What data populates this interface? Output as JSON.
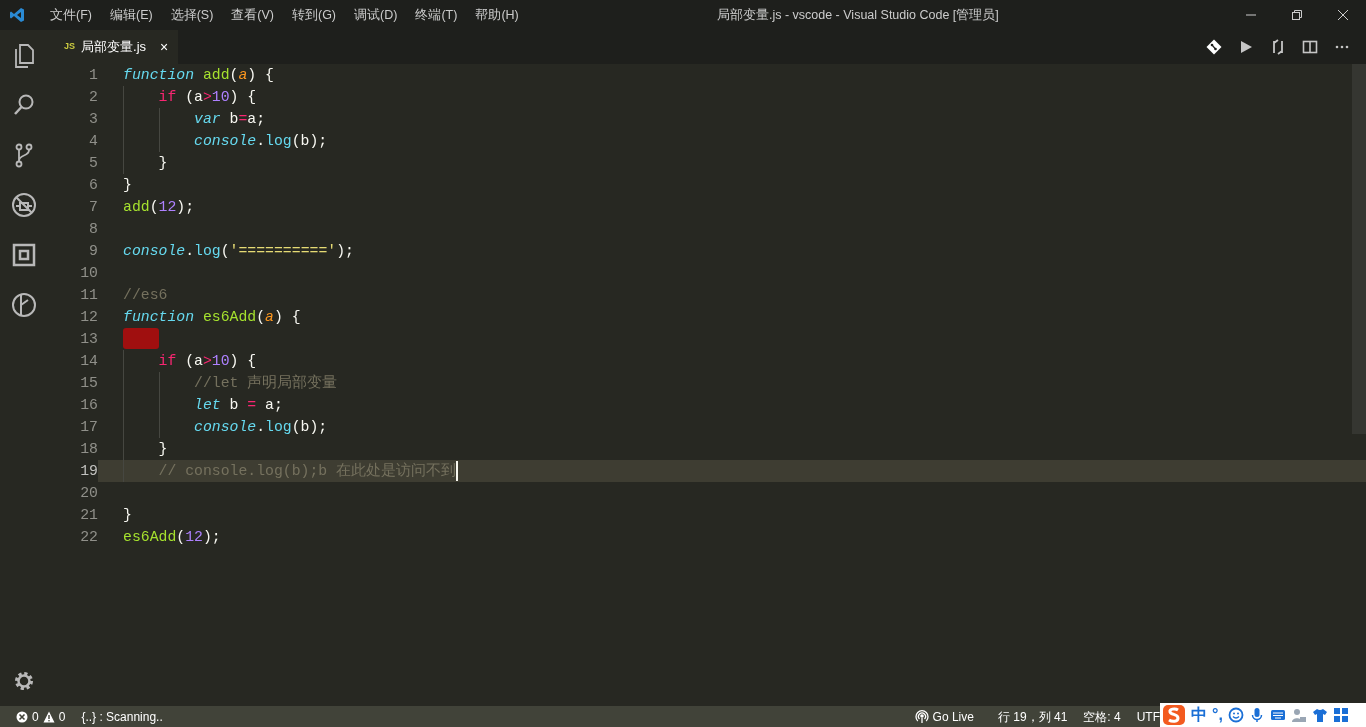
{
  "window": {
    "title": "局部变量.js - vscode - Visual Studio Code [管理员]"
  },
  "menu": [
    "文件(F)",
    "编辑(E)",
    "选择(S)",
    "查看(V)",
    "转到(G)",
    "调试(D)",
    "终端(T)",
    "帮助(H)"
  ],
  "tabs": [
    {
      "badge": "JS",
      "label": "局部变量.js",
      "close": "×",
      "selected": true
    }
  ],
  "editor": {
    "lines": [
      {
        "number": "1",
        "current": false,
        "error": false,
        "tokens": [
          {
            "kind": "keyword",
            "text": "function"
          },
          {
            "kind": "function",
            "text": " add"
          },
          {
            "kind": "plain",
            "text": "("
          },
          {
            "kind": "param",
            "text": "a"
          },
          {
            "kind": "plain",
            "text": ") {"
          }
        ]
      },
      {
        "number": "2",
        "current": false,
        "error": false,
        "tokens": [
          {
            "kind": "control",
            "text": "    if"
          },
          {
            "kind": "plain",
            "text": " (a"
          },
          {
            "kind": "operator",
            "text": ">"
          },
          {
            "kind": "number",
            "text": "10"
          },
          {
            "kind": "plain",
            "text": ") {"
          }
        ]
      },
      {
        "number": "3",
        "current": false,
        "error": false,
        "tokens": [
          {
            "kind": "keyword",
            "text": "        var"
          },
          {
            "kind": "plain",
            "text": " b"
          },
          {
            "kind": "operator",
            "text": "="
          },
          {
            "kind": "plain",
            "text": "a;"
          }
        ]
      },
      {
        "number": "4",
        "current": false,
        "error": false,
        "tokens": [
          {
            "kind": "keyword",
            "text": "        console"
          },
          {
            "kind": "plain",
            "text": "."
          },
          {
            "kind": "method",
            "text": "log"
          },
          {
            "kind": "plain",
            "text": "(b);"
          }
        ]
      },
      {
        "number": "5",
        "current": false,
        "error": false,
        "tokens": [
          {
            "kind": "plain",
            "text": "    }"
          }
        ]
      },
      {
        "number": "6",
        "current": false,
        "error": false,
        "tokens": [
          {
            "kind": "plain",
            "text": "}"
          }
        ]
      },
      {
        "number": "7",
        "current": false,
        "error": false,
        "tokens": [
          {
            "kind": "function",
            "text": "add"
          },
          {
            "kind": "plain",
            "text": "("
          },
          {
            "kind": "number",
            "text": "12"
          },
          {
            "kind": "plain",
            "text": ");"
          }
        ]
      },
      {
        "number": "8",
        "current": false,
        "error": false
      },
      {
        "number": "9",
        "current": false,
        "error": false,
        "tokens": [
          {
            "kind": "keyword",
            "text": "console"
          },
          {
            "kind": "plain",
            "text": "."
          },
          {
            "kind": "method",
            "text": "log"
          },
          {
            "kind": "plain",
            "text": "("
          },
          {
            "kind": "string",
            "text": "'=========='"
          },
          {
            "kind": "plain",
            "text": ");"
          }
        ]
      },
      {
        "number": "10",
        "current": false,
        "error": false
      },
      {
        "number": "11",
        "current": false,
        "error": false,
        "tokens": [
          {
            "kind": "comment",
            "text": "//es6"
          }
        ]
      },
      {
        "number": "12",
        "current": false,
        "error": false,
        "tokens": [
          {
            "kind": "keyword",
            "text": "function"
          },
          {
            "kind": "function",
            "text": " es6Add"
          },
          {
            "kind": "plain",
            "text": "("
          },
          {
            "kind": "param",
            "text": "a"
          },
          {
            "kind": "plain",
            "text": ") {"
          }
        ]
      },
      {
        "number": "13",
        "current": false,
        "error": true
      },
      {
        "number": "14",
        "current": false,
        "error": false,
        "tokens": [
          {
            "kind": "control",
            "text": "    if"
          },
          {
            "kind": "plain",
            "text": " (a"
          },
          {
            "kind": "operator",
            "text": ">"
          },
          {
            "kind": "number",
            "text": "10"
          },
          {
            "kind": "plain",
            "text": ") {"
          }
        ]
      },
      {
        "number": "15",
        "current": false,
        "error": false,
        "tokens": [
          {
            "kind": "comment",
            "text": "        //let 声明局部变量"
          }
        ]
      },
      {
        "number": "16",
        "current": false,
        "error": false,
        "tokens": [
          {
            "kind": "keyword",
            "text": "        let"
          },
          {
            "kind": "plain",
            "text": " b "
          },
          {
            "kind": "operator",
            "text": "="
          },
          {
            "kind": "plain",
            "text": " a;"
          }
        ]
      },
      {
        "number": "17",
        "current": false,
        "error": false,
        "tokens": [
          {
            "kind": "keyword",
            "text": "        console"
          },
          {
            "kind": "plain",
            "text": "."
          },
          {
            "kind": "method",
            "text": "log"
          },
          {
            "kind": "plain",
            "text": "(b);"
          }
        ]
      },
      {
        "number": "18",
        "current": false,
        "error": false,
        "tokens": [
          {
            "kind": "plain",
            "text": "    }"
          }
        ]
      },
      {
        "number": "19",
        "current": true,
        "error": false,
        "tokens": [
          {
            "kind": "comment",
            "text": "    // console.log(b);b 在此处是访问不到"
          }
        ]
      },
      {
        "number": "20",
        "current": false,
        "error": false
      },
      {
        "number": "21",
        "current": false,
        "error": false,
        "tokens": [
          {
            "kind": "plain",
            "text": "}"
          }
        ]
      },
      {
        "number": "22",
        "current": false,
        "error": false,
        "tokens": [
          {
            "kind": "function",
            "text": "es6Add"
          },
          {
            "kind": "plain",
            "text": "("
          },
          {
            "kind": "number",
            "text": "12"
          },
          {
            "kind": "plain",
            "text": ");"
          }
        ]
      }
    ]
  },
  "status_bar": {
    "errors": "0",
    "warnings": "0",
    "scanning": "{..} : Scanning..",
    "go_live": "Go Live",
    "position": "行 19，列 41",
    "indentation": "空格: 4",
    "encoding": "UTF"
  },
  "ime_toolbar": {
    "mode": "中",
    "punctuation": "°,"
  }
}
